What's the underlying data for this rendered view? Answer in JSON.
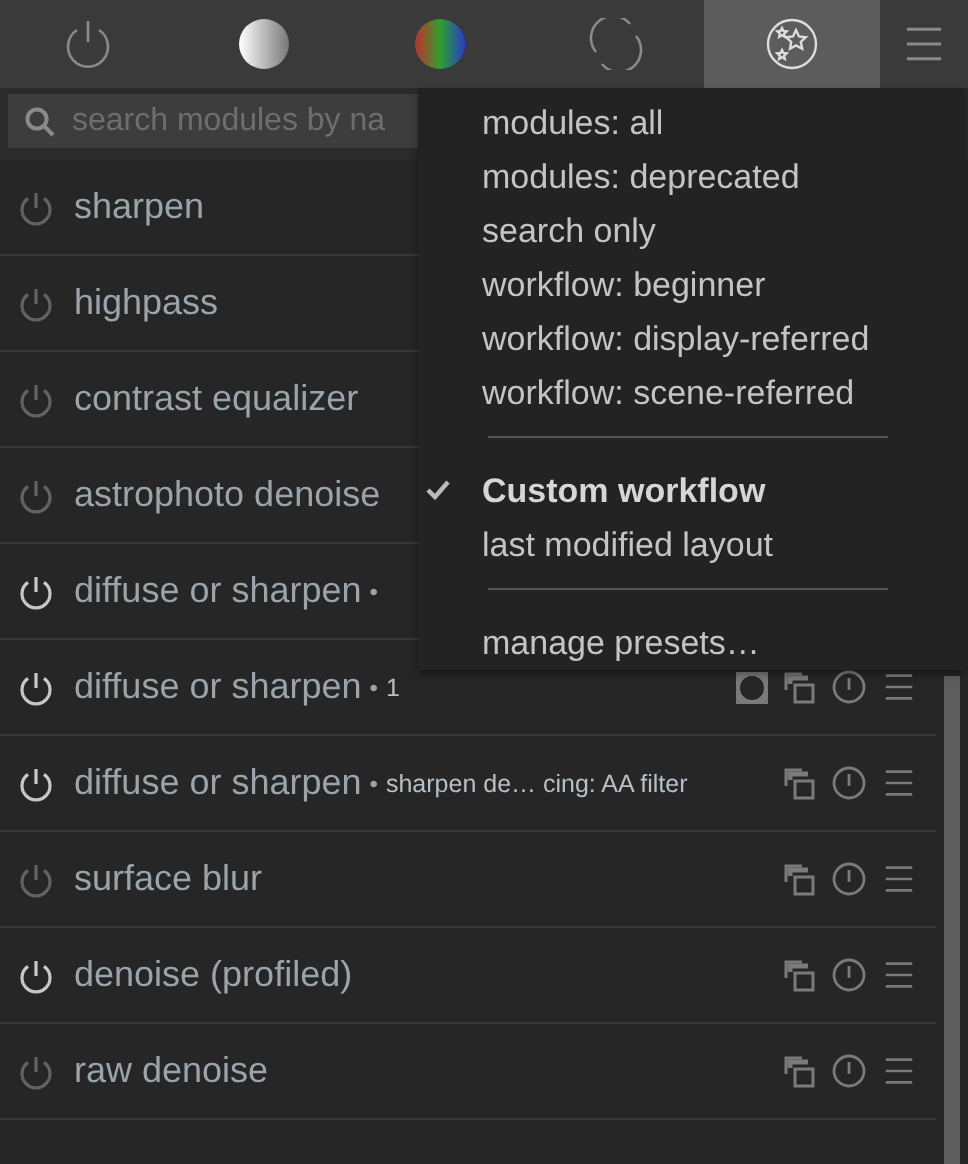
{
  "tabs": [
    {
      "kind": "power",
      "selected": false
    },
    {
      "kind": "gray",
      "selected": false
    },
    {
      "kind": "rgb",
      "selected": false
    },
    {
      "kind": "cycle",
      "selected": false
    },
    {
      "kind": "stars",
      "selected": true
    }
  ],
  "search": {
    "placeholder": "search modules by na"
  },
  "modules": [
    {
      "name": "sharpen",
      "enabled": false
    },
    {
      "name": "highpass",
      "enabled": false
    },
    {
      "name": "contrast equalizer",
      "enabled": false
    },
    {
      "name": "astrophoto denoise",
      "enabled": false
    },
    {
      "name": "diffuse or sharpen",
      "enabled": true,
      "dot": "•"
    },
    {
      "name": "diffuse or sharpen",
      "enabled": true,
      "dot": "•",
      "instance": "1",
      "mask": true
    },
    {
      "name": "diffuse or sharpen",
      "enabled": true,
      "dot": "•",
      "instance": "sharpen de… cing: AA filter"
    },
    {
      "name": "surface blur",
      "enabled": false
    },
    {
      "name": "denoise (profiled)",
      "enabled": true
    },
    {
      "name": "raw denoise",
      "enabled": false
    }
  ],
  "menu": {
    "groups": [
      [
        {
          "label": "modules: all",
          "selected": false
        },
        {
          "label": "modules: deprecated",
          "selected": false
        },
        {
          "label": "search only",
          "selected": false
        },
        {
          "label": "workflow: beginner",
          "selected": false
        },
        {
          "label": "workflow: display-referred",
          "selected": false
        },
        {
          "label": "workflow: scene-referred",
          "selected": false
        }
      ],
      [
        {
          "label": "Custom workflow",
          "selected": true
        },
        {
          "label": "last modified layout",
          "selected": false
        }
      ],
      [
        {
          "label": "manage presets…",
          "selected": false
        }
      ]
    ]
  }
}
